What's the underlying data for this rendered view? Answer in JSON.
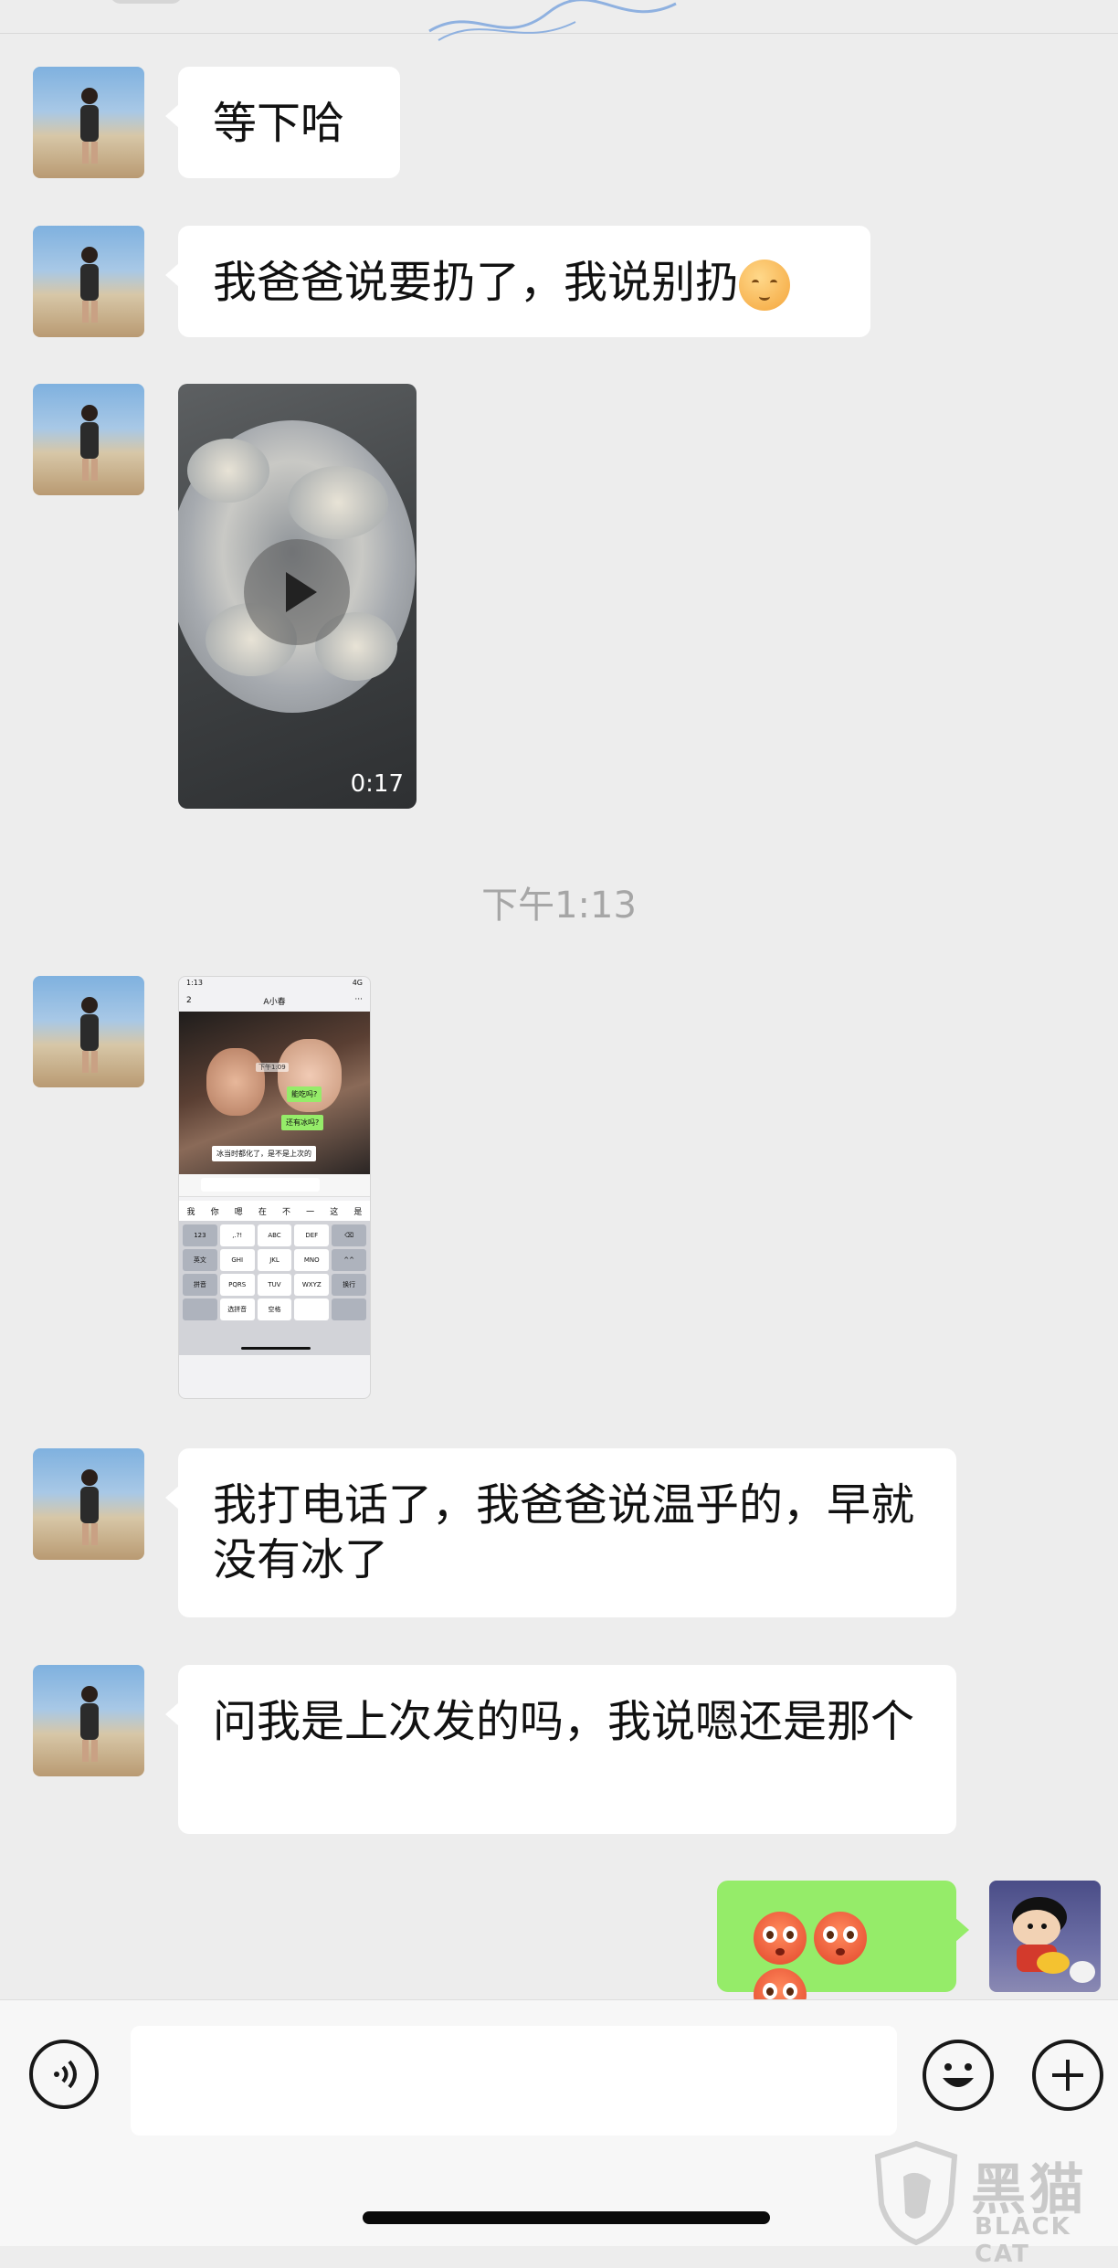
{
  "messages": [
    {
      "id": "m1",
      "sender": "contact",
      "type": "text",
      "text": "等下哈"
    },
    {
      "id": "m2",
      "sender": "contact",
      "type": "text",
      "text": "我爸爸说要扔了，我说别扔",
      "emoji": "smiling-face"
    },
    {
      "id": "m3",
      "sender": "contact",
      "type": "video",
      "duration": "0:17"
    },
    {
      "id": "m4",
      "sender": "contact",
      "type": "image"
    },
    {
      "id": "m5",
      "sender": "contact",
      "type": "text",
      "text": "我打电话了，我爸爸说温乎的，早就没有冰了"
    },
    {
      "id": "m6",
      "sender": "contact",
      "type": "text",
      "text": "问我是上次发的吗，我说嗯还是那个"
    },
    {
      "id": "m7",
      "sender": "me",
      "type": "emoji",
      "emojis": [
        "flushed-face",
        "flushed-face",
        "flushed-face"
      ]
    }
  ],
  "timestamp": "下午1:13",
  "screenshot": {
    "status_time": "1:13",
    "status_signal": "4G",
    "back_count": "2",
    "chat_title": "A小春",
    "more": "···",
    "time_label": "下午1:09",
    "bubble1": "能吃吗?",
    "bubble2": "还有冰吗?",
    "bubble3": "冰当时都化了，是不是上次的",
    "candidates": [
      "我",
      "你",
      "嗯",
      "在",
      "不",
      "一",
      "这",
      "是"
    ],
    "keys": [
      "123",
      ",.?!",
      "ABC",
      "DEF",
      "⌫",
      "英文",
      "GHI",
      "JKL",
      "MNO",
      "^^",
      "拼音",
      "PQRS",
      "TUV",
      "WXYZ",
      "换行",
      "",
      "选拼音",
      "空格",
      "",
      ""
    ]
  },
  "input_bar": {
    "voice_icon": "voice-icon",
    "emoji_icon": "emoji-icon",
    "plus_icon": "plus-icon",
    "placeholder": ""
  },
  "watermark": {
    "cn": "黑猫",
    "en": "BLACK CAT"
  },
  "colors": {
    "background": "#ededed",
    "bubble_contact": "#ffffff",
    "bubble_me": "#95ec69"
  }
}
